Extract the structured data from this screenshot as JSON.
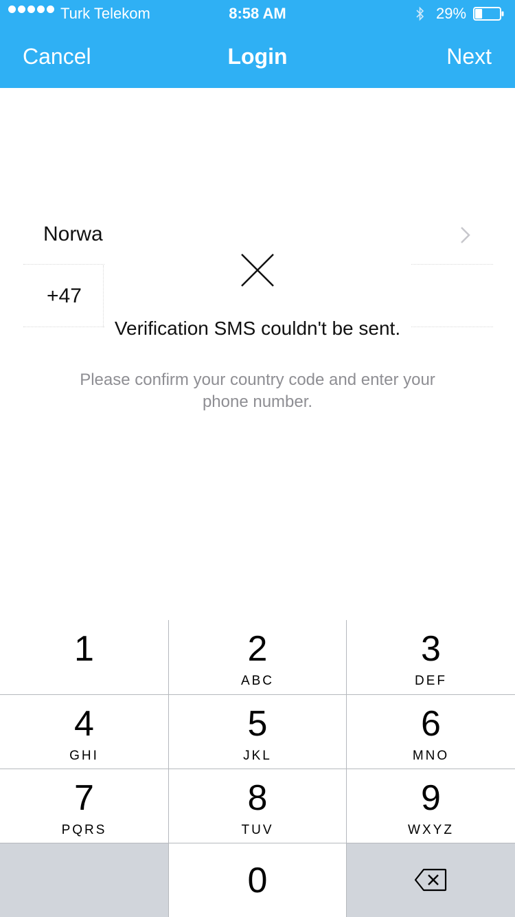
{
  "status_bar": {
    "carrier": "Turk Telekom",
    "time": "8:58 AM",
    "battery_percent": "29%",
    "battery_level": 0.29,
    "signal_icon": "signal-dots-icon",
    "bluetooth_icon": "bluetooth-icon",
    "battery_icon": "battery-icon"
  },
  "nav": {
    "cancel_label": "Cancel",
    "title": "Login",
    "next_label": "Next"
  },
  "form": {
    "country_name": "Norwa",
    "country_code": "+47",
    "chevron_icon": "chevron-right-icon",
    "hint": "Please confirm your country code and enter your phone number."
  },
  "error_toast": {
    "icon": "close-icon",
    "message": "Verification SMS couldn't be sent."
  },
  "keypad": {
    "keys": [
      {
        "num": "1",
        "letters": ""
      },
      {
        "num": "2",
        "letters": "ABC"
      },
      {
        "num": "3",
        "letters": "DEF"
      },
      {
        "num": "4",
        "letters": "GHI"
      },
      {
        "num": "5",
        "letters": "JKL"
      },
      {
        "num": "6",
        "letters": "MNO"
      },
      {
        "num": "7",
        "letters": "PQRS"
      },
      {
        "num": "8",
        "letters": "TUV"
      },
      {
        "num": "9",
        "letters": "WXYZ"
      },
      {
        "num": "0",
        "letters": ""
      }
    ],
    "backspace_icon": "backspace-icon"
  },
  "colors": {
    "nav_blue": "#2fb0f4",
    "hint_gray": "#8e8e93",
    "keypad_gray": "#d1d5db"
  }
}
